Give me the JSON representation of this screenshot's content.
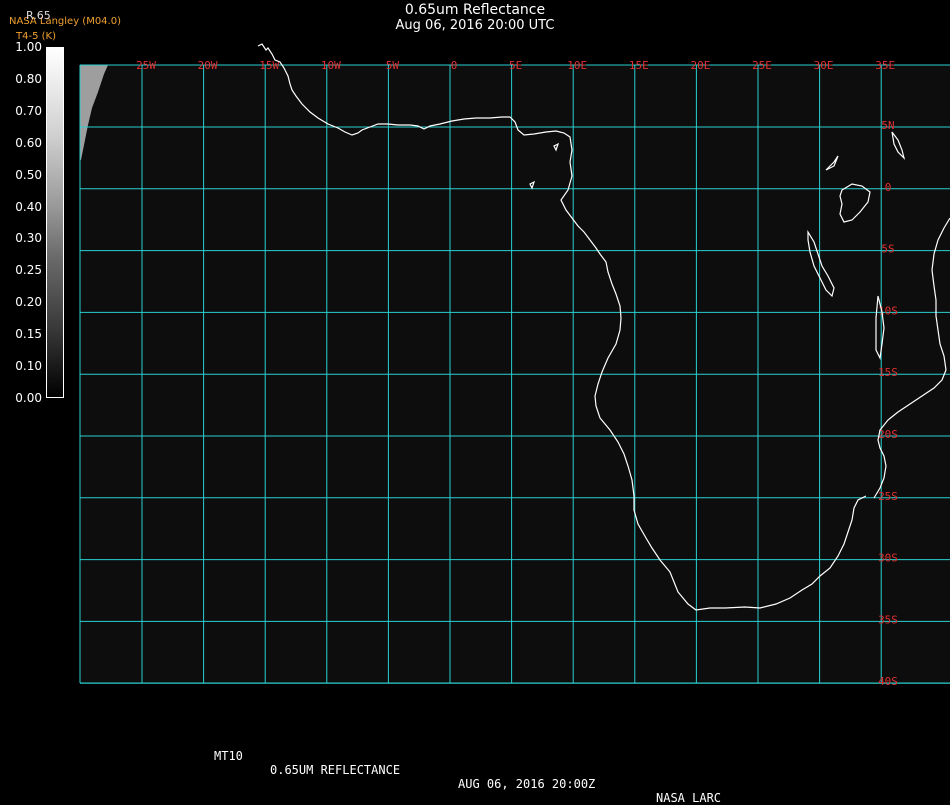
{
  "title": {
    "line1": "0.65um Reflectance",
    "line2": "Aug 06, 2016 20:00 UTC"
  },
  "credit": {
    "line1": "NASA Langley (M04.0)",
    "line2": "T4-5 (K)"
  },
  "colorbar": {
    "top_value": "R.65",
    "labels": [
      "1.00",
      "0.80",
      "0.70",
      "0.60",
      "0.50",
      "0.40",
      "0.30",
      "0.25",
      "0.20",
      "0.15",
      "0.10",
      "0.00"
    ]
  },
  "map": {
    "background": "#0d0d0d",
    "grid_color": "#2ad0d0",
    "label_color": "#e03030",
    "coast_color": "#ffffff",
    "lon_labels": [
      "25W",
      "20W",
      "15W",
      "10W",
      "5W",
      "0",
      "5E",
      "10E",
      "15E",
      "20E",
      "25E",
      "30E",
      "35E"
    ],
    "lat_labels": [
      "5N",
      "0",
      "5S",
      "10S",
      "15S",
      "20S",
      "25S",
      "30S",
      "35S",
      "40S"
    ]
  },
  "footer": {
    "sat": "MT10",
    "product": "0.65UM REFLECTANCE",
    "datetime": "AUG 06, 2016 20:00Z",
    "org": "NASA LARC"
  }
}
